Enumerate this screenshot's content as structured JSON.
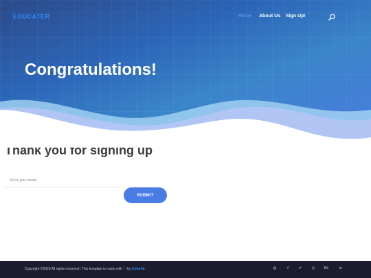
{
  "nav": {
    "brand": "EDUCATER",
    "links": [
      "Home",
      "About Us",
      "Sign Up!"
    ],
    "search_icon": "search-icon"
  },
  "hero": {
    "title": "Congratulations!"
  },
  "main": {
    "heading": "Thank you for signing up",
    "input_placeholder": "Tell us your needs",
    "input_value": "",
    "submit_label": "SUBMIT"
  },
  "footer": {
    "copyright": "Copyright ©2023 All rights reserved | This template is made with",
    "heart": "♡",
    "by": "by",
    "credit": "Colorlib",
    "social_icons": [
      {
        "name": "dribbble-icon",
        "glyph": "◍"
      },
      {
        "name": "facebook-icon",
        "glyph": "f"
      },
      {
        "name": "twitter-icon",
        "glyph": "✔"
      },
      {
        "name": "instagram-icon",
        "glyph": "◎"
      },
      {
        "name": "behance-icon",
        "glyph": "Bē"
      },
      {
        "name": "linkedin-icon",
        "glyph": "in"
      }
    ]
  },
  "colors": {
    "brand": "#2d8cff",
    "accent": "#4a7ce6",
    "footer_bg": "#1b1c2e"
  }
}
